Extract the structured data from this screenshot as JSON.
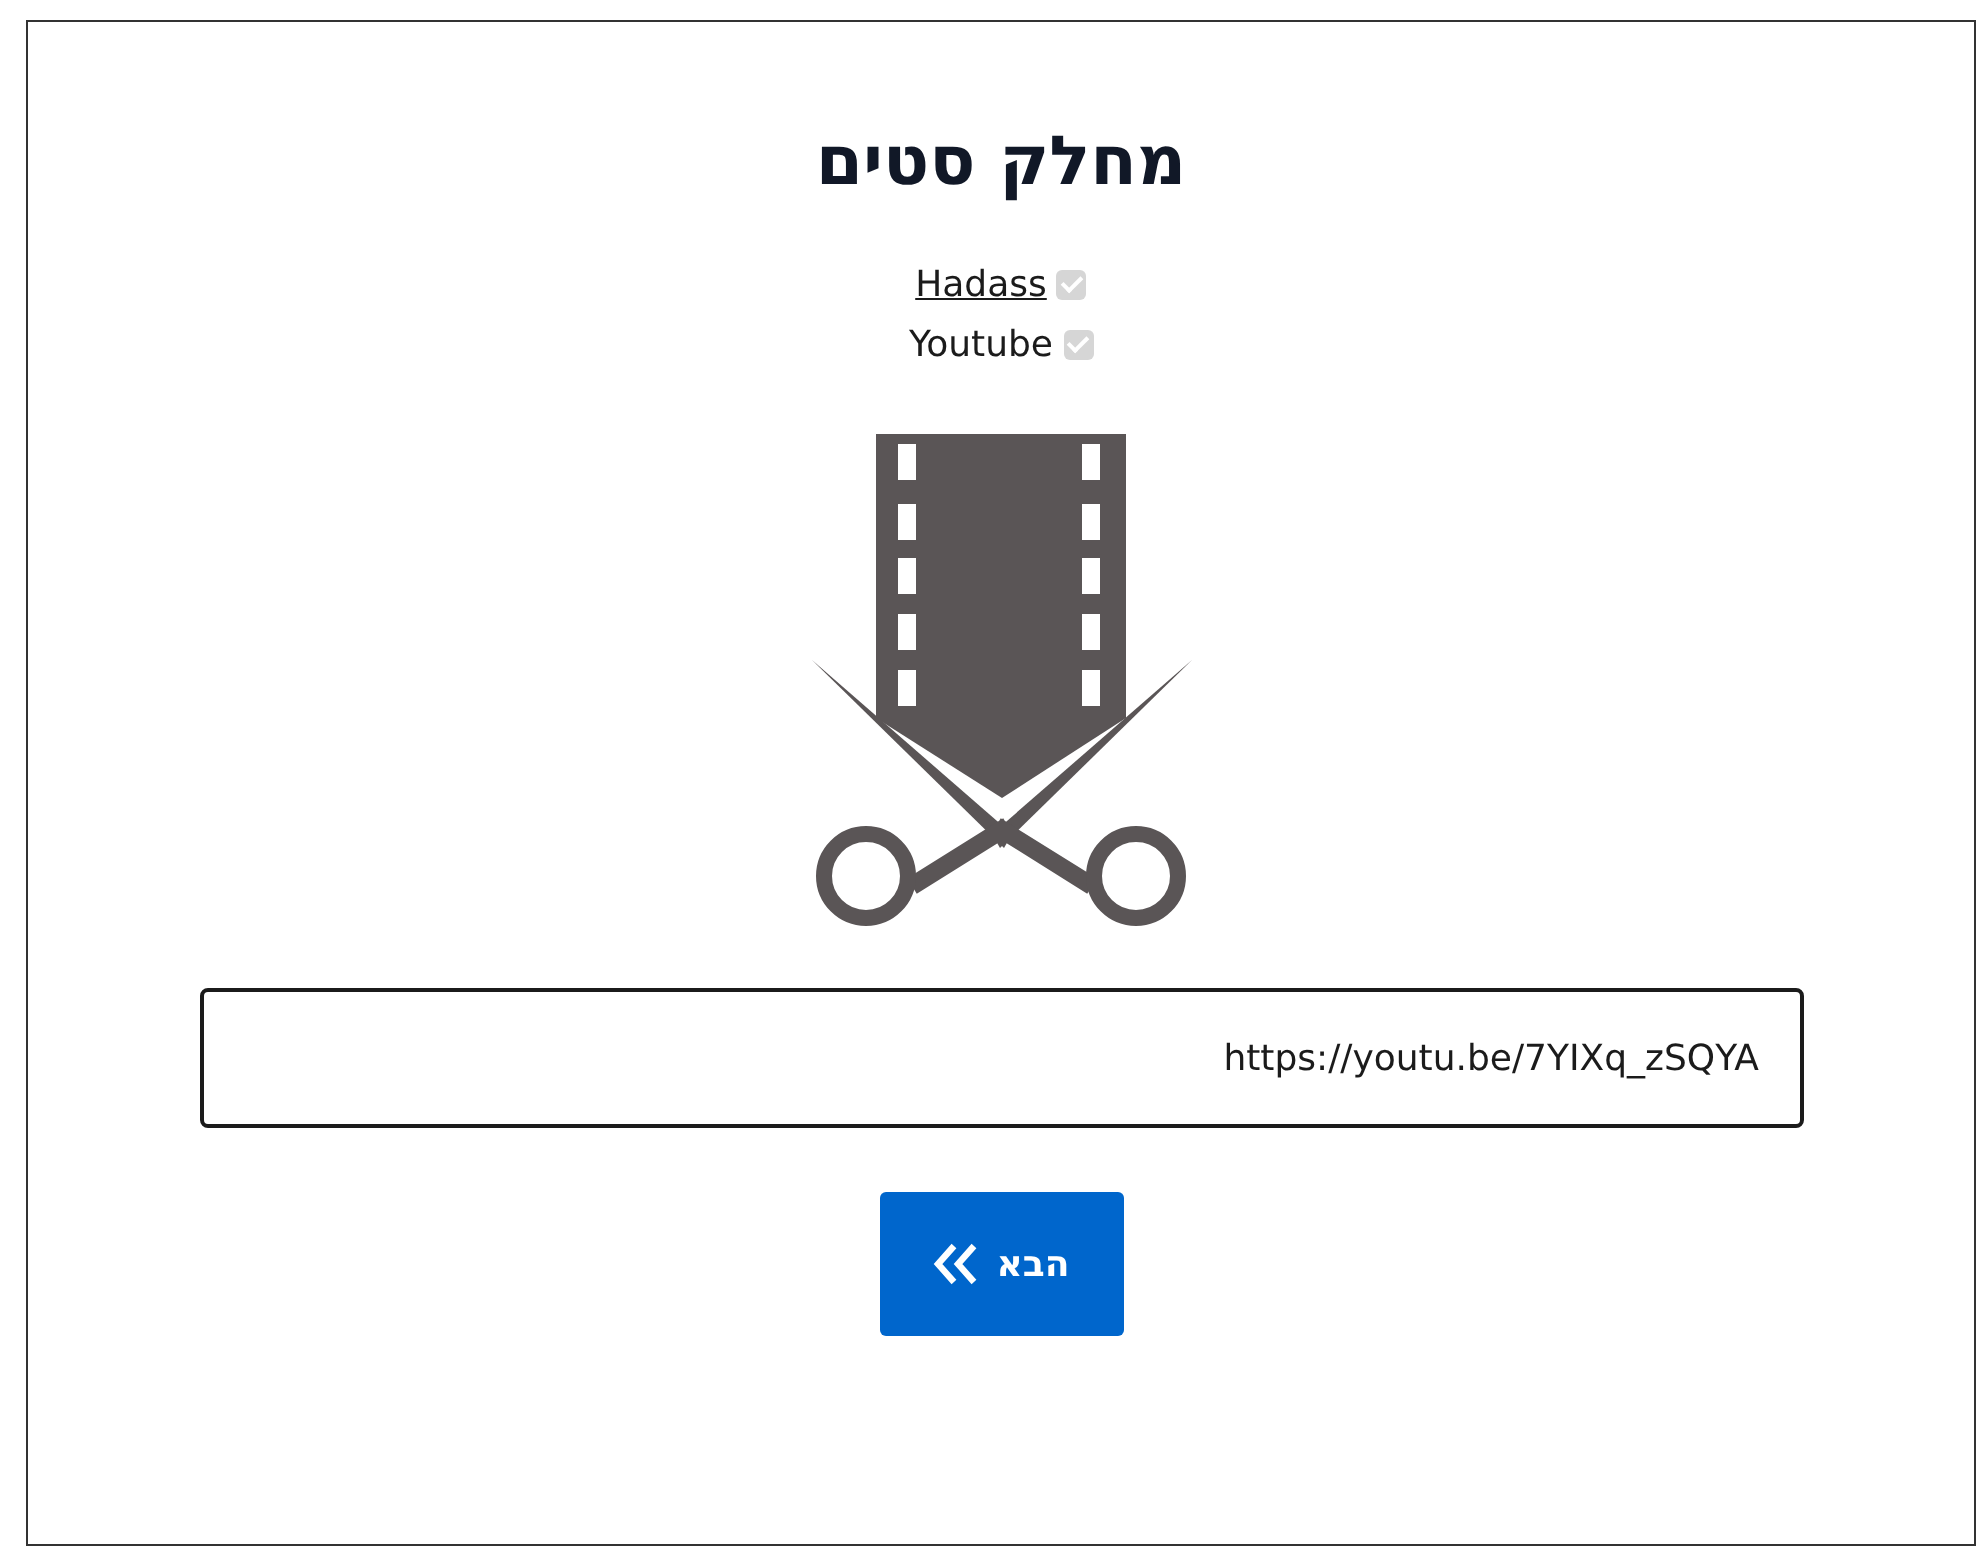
{
  "title": "מחלק סטים",
  "sources": [
    {
      "label": "Hadass",
      "kind": "link",
      "checked": true,
      "disabled": true
    },
    {
      "label": "Youtube",
      "kind": "text",
      "checked": true,
      "disabled": true
    }
  ],
  "url_field": {
    "value": "https://youtu.be/7YIXq_zSQYA"
  },
  "next_button": {
    "label": "הבא"
  }
}
